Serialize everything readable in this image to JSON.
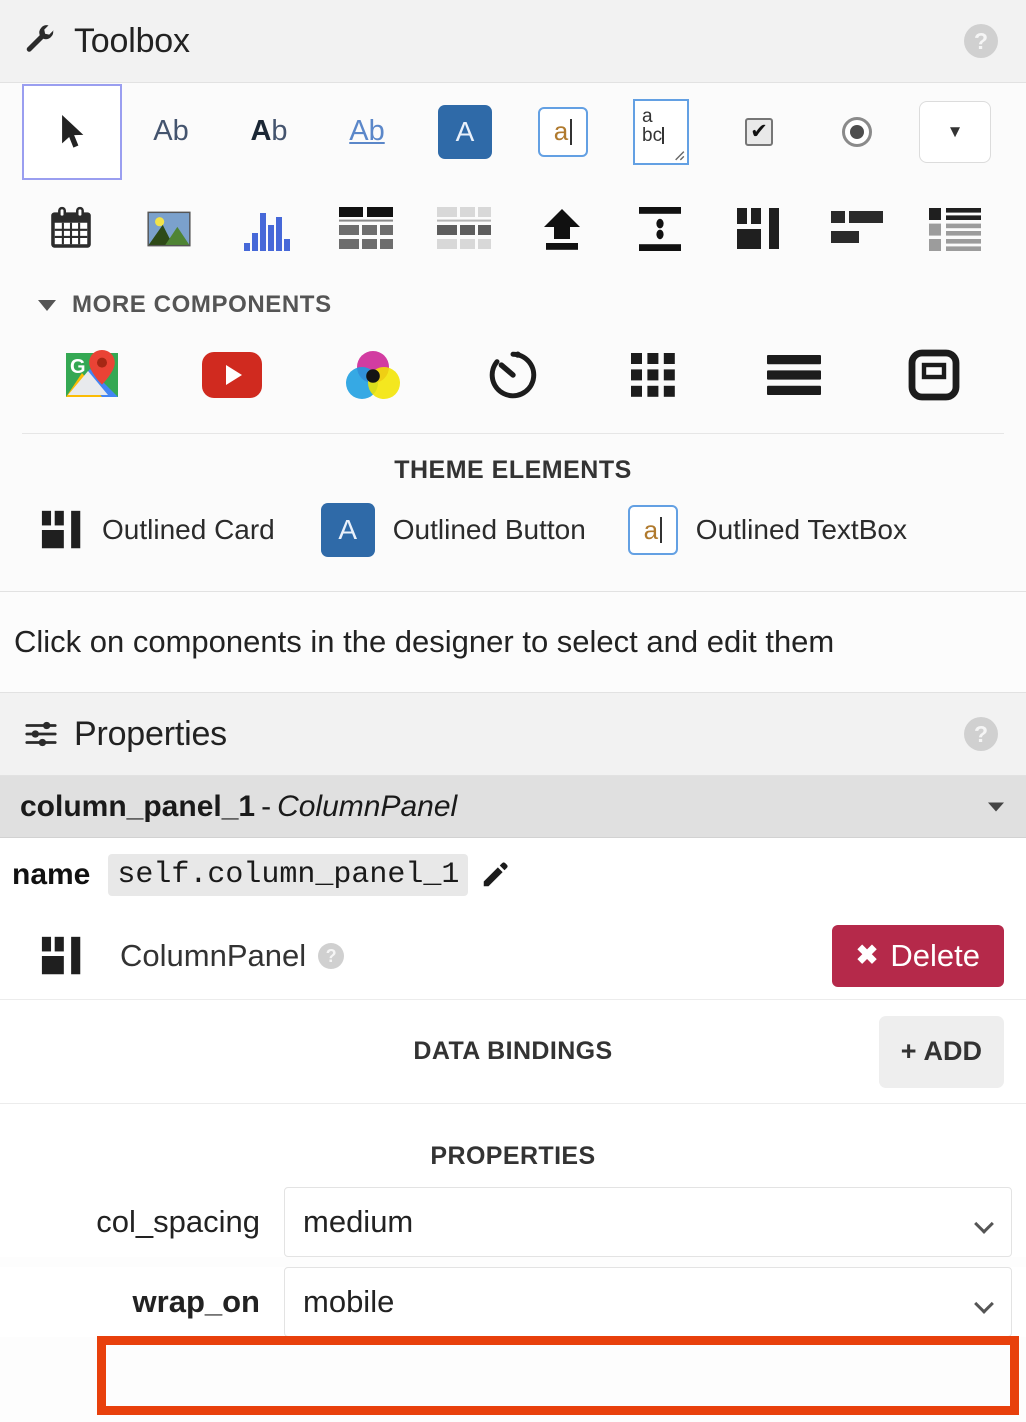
{
  "toolbox": {
    "title": "Toolbox",
    "help_label": "?",
    "tools_row1": [
      {
        "name": "select-cursor-tool",
        "label": "",
        "selected": true
      },
      {
        "name": "label-tool",
        "label": "Ab"
      },
      {
        "name": "bold-label-tool",
        "label": "Ab"
      },
      {
        "name": "link-tool",
        "label": "Ab"
      },
      {
        "name": "button-tool",
        "label": "A"
      },
      {
        "name": "textbox-tool",
        "label": "a"
      },
      {
        "name": "textarea-tool",
        "label": "a bc"
      },
      {
        "name": "checkbox-tool",
        "label": "✔"
      },
      {
        "name": "radiobutton-tool",
        "label": ""
      },
      {
        "name": "dropdown-tool",
        "label": "▼"
      }
    ],
    "tools_row2": [
      {
        "name": "datepicker-tool",
        "label": ""
      },
      {
        "name": "image-tool",
        "label": ""
      },
      {
        "name": "plot-tool",
        "label": ""
      },
      {
        "name": "datagrid-tool",
        "label": ""
      },
      {
        "name": "repeatingpanel-tool",
        "label": ""
      },
      {
        "name": "fileloader-tool",
        "label": ""
      },
      {
        "name": "spacer-tool",
        "label": ""
      },
      {
        "name": "columnpanel-tool",
        "label": ""
      },
      {
        "name": "flowpanel-tool",
        "label": ""
      },
      {
        "name": "linearpanel-tool",
        "label": ""
      }
    ],
    "more_components": {
      "title": "MORE COMPONENTS",
      "expanded": true,
      "items": [
        {
          "name": "google-map-icon"
        },
        {
          "name": "youtube-video-icon"
        },
        {
          "name": "color-wheel-icon"
        },
        {
          "name": "timer-icon"
        },
        {
          "name": "grid-icon"
        },
        {
          "name": "menu-bars-icon"
        },
        {
          "name": "canvas-icon"
        }
      ]
    },
    "theme_elements": {
      "title": "THEME ELEMENTS",
      "items": [
        {
          "name": "outlined-card",
          "label": "Outlined Card"
        },
        {
          "name": "outlined-button",
          "label": "Outlined Button",
          "glyph": "A"
        },
        {
          "name": "outlined-textbox",
          "label": "Outlined TextBox",
          "glyph": "a"
        }
      ]
    }
  },
  "hint": {
    "text": "Click on components in the designer to select and edit them"
  },
  "properties_panel": {
    "title": "Properties",
    "help_label": "?",
    "selected_component": {
      "name": "column_panel_1",
      "dash": "-",
      "type": "ColumnPanel"
    },
    "name_field": {
      "label": "name",
      "value": "self.column_panel_1",
      "edit_icon": "pencil-icon"
    },
    "component_row": {
      "type_label": "ColumnPanel",
      "help_label": "?",
      "delete_label": "Delete",
      "delete_glyph": "✖",
      "delete_color": "#b5294a"
    },
    "data_bindings": {
      "title": "DATA BINDINGS",
      "add_label": "ADD",
      "add_glyph": "+"
    },
    "properties_section": {
      "title": "PROPERTIES",
      "rows": [
        {
          "name": "col_spacing",
          "label": "col_spacing",
          "value": "medium",
          "highlighted": false
        },
        {
          "name": "wrap_on",
          "label": "wrap_on",
          "value": "mobile",
          "highlighted": true
        }
      ]
    }
  },
  "highlight": {
    "color": "#e8400c",
    "target": "wrap_on"
  }
}
